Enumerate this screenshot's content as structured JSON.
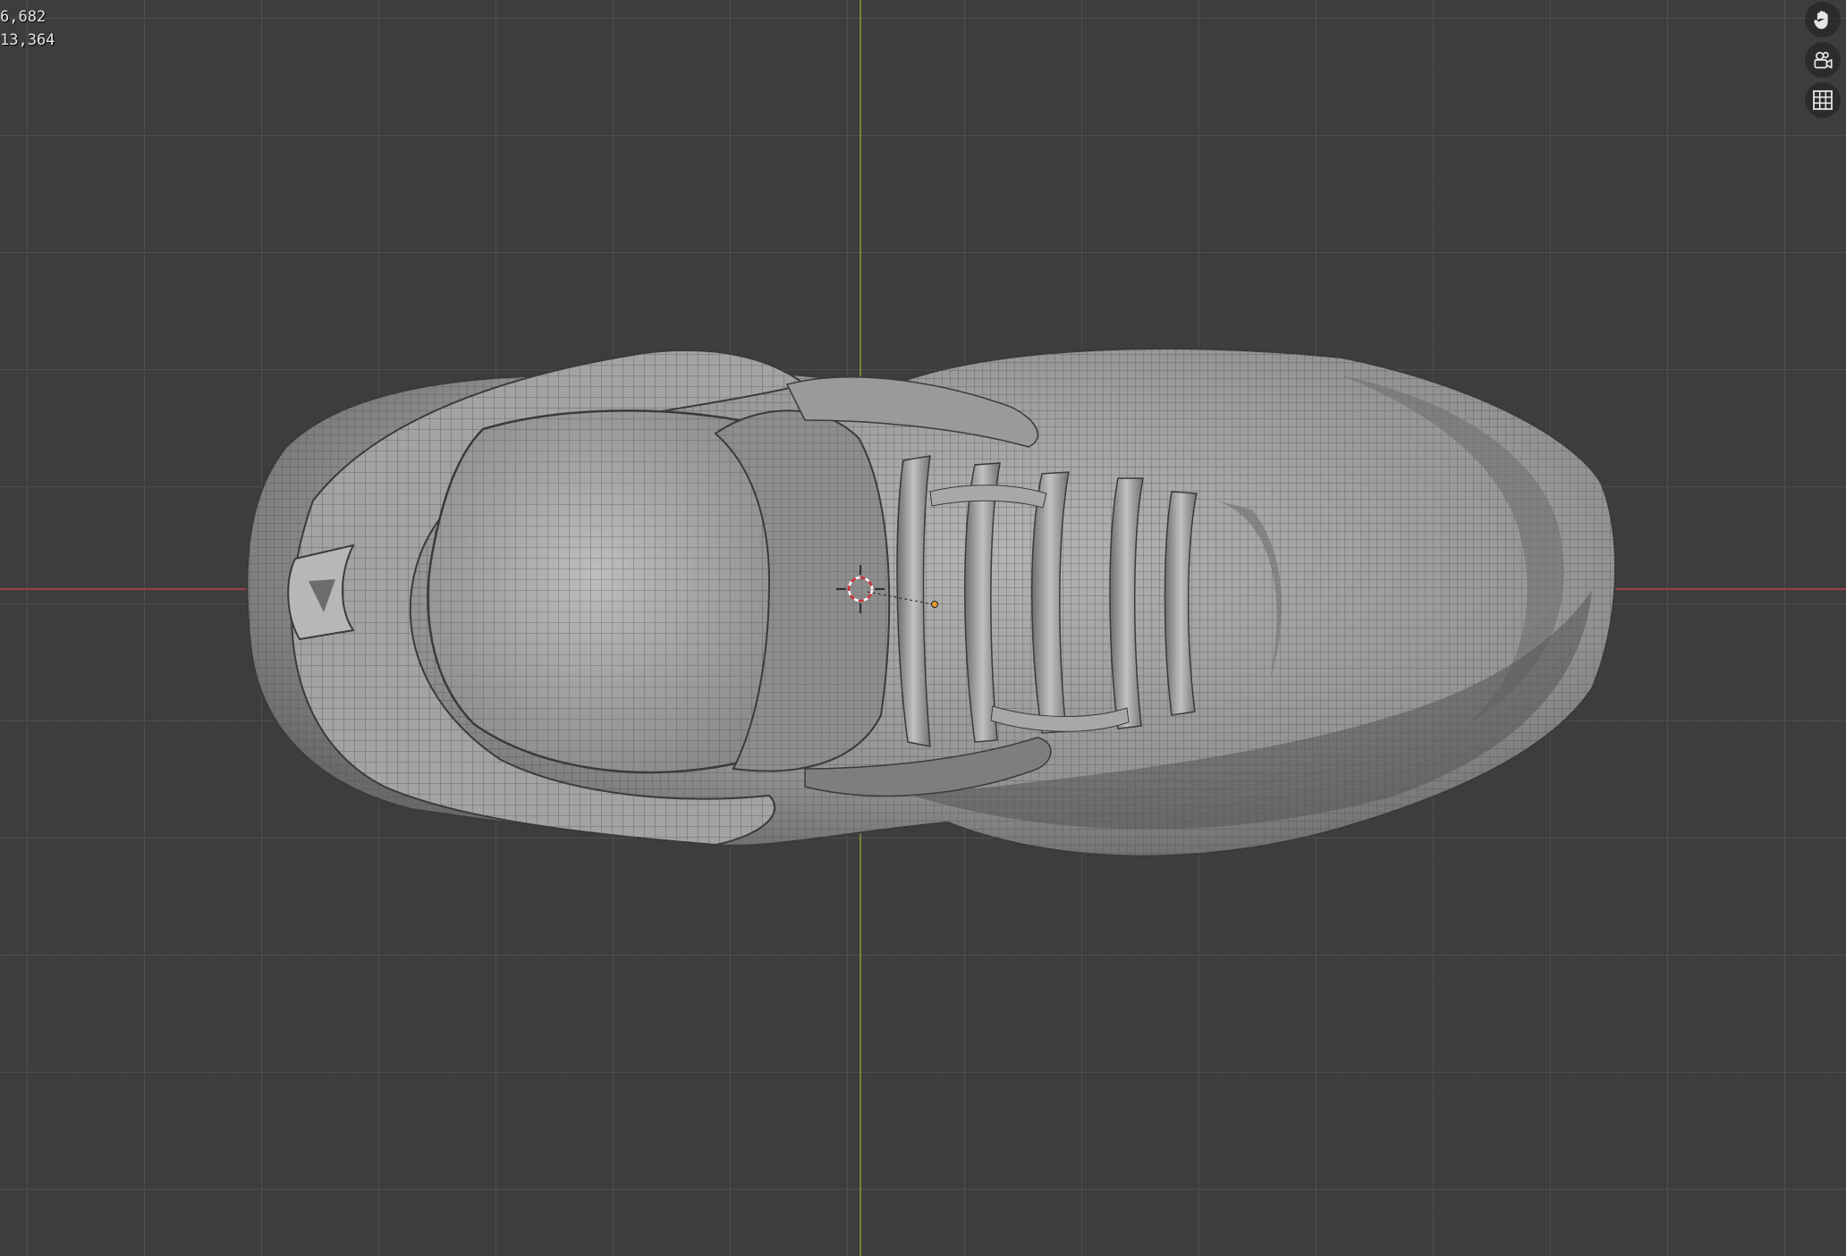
{
  "viewport": {
    "stats": {
      "line1": "6,682",
      "line2": "13,364"
    },
    "navigation": {
      "pan_icon": "hand-icon",
      "camera_icon": "camera-icon",
      "ortho_icon": "grid-icon"
    },
    "colors": {
      "background": "#3d3d3d",
      "x_axis": "#b5424a",
      "y_axis": "#7f9a3a",
      "mesh": "#9c9c9c",
      "wire": "#3a3a3a"
    }
  }
}
